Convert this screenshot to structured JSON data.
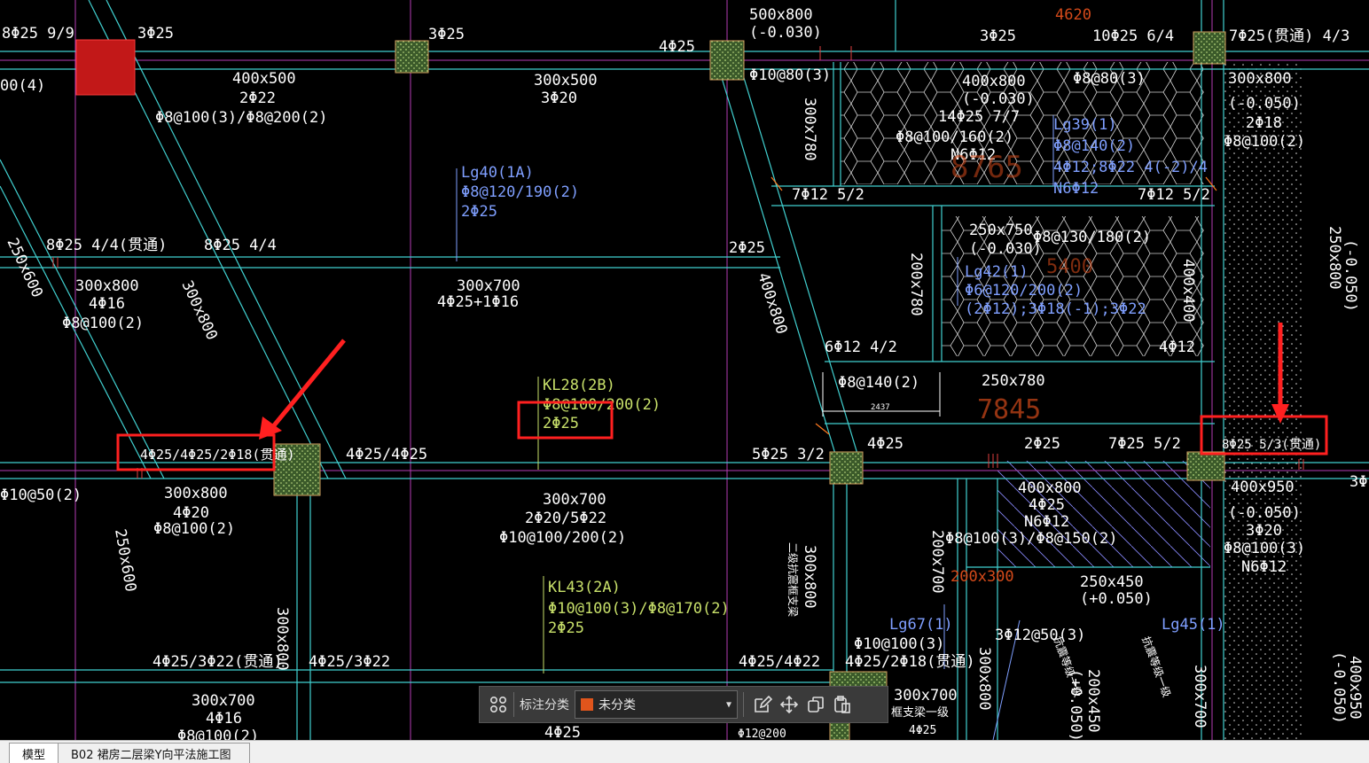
{
  "drawing": {
    "labels": {
      "a1": "8Φ25 9/9",
      "a2": "3Φ25",
      "a3": "00(4)",
      "a4": "3Φ25",
      "a5": "4Φ25",
      "a6": "500x800",
      "a7": "(-0.030)",
      "a8": "Φ10@80(3)",
      "a9": "3Φ25",
      "a10": "10Φ25 6/4",
      "a11": "7Φ25(贯通) 4/3",
      "a12": "4620",
      "a13": "400x500",
      "a14": "2Φ22",
      "a15": "Φ8@100(3)/Φ8@200(2)",
      "a16": "300x500",
      "a17": "3Φ20",
      "a18": "400x800",
      "a19": "(-0.030)",
      "a20": "14Φ25 7/7",
      "a21": "Φ8@100/160(2)",
      "a22": "N6Φ12",
      "a23": "Φ8@80(3)",
      "a24": "Lg39(1)",
      "a25": "Φ8@140(2)",
      "a26": "4Φ12;8Φ22 4(-2)/4",
      "a27": "N6Φ12",
      "a28": "8765",
      "a29": "300x800",
      "a30": "(-0.050)",
      "a31": "2Φ18",
      "a32": "Φ8@100(2)",
      "a33": "300x780",
      "a34": "Lg40(1A)",
      "a35": "Φ8@120/190(2)",
      "a36": "2Φ25",
      "a37": "7Φ12 5/2",
      "a38": "7Φ12 5/2",
      "a39": "8Φ25 4/4(贯通)",
      "a40": "8Φ25 4/4",
      "a41": "2Φ25",
      "a42": "250x750",
      "a43": "(-0.030)",
      "a44": "Φ8@130/180(2)",
      "a45": "Lg42(1)",
      "a46": "Φ6@120/200(2)",
      "a47": "(2Φ12);3Φ18(-1);3Φ22",
      "a48": "5400",
      "a49": "250x600",
      "a50": "300x800",
      "a51": "4Φ16",
      "a52": "Φ8@100(2)",
      "a53": "300x800",
      "a54": "300x700",
      "a55": "4Φ25+1Φ16",
      "a56": "400x800",
      "a57": "200x780",
      "a58": "400x400",
      "a59": "250x800",
      "a60": "(-0.050)",
      "a61": "6Φ12 4/2",
      "a62": "4Φ12",
      "a63": "Φ8@140(2)",
      "a64": "2437",
      "a65": "250x780",
      "a66": "7845",
      "a67": "KL28(2B)",
      "a68": "Φ8@100/200(2)",
      "a69": "2Φ25",
      "a70": "4Φ25/4Φ25/2Φ18(贯通)",
      "a71": "4Φ25/4Φ25",
      "a72": "5Φ25 3/2",
      "a73": "4Φ25",
      "a74": "2Φ25",
      "a75": "7Φ25 5/2",
      "a76": "8Φ25 5/3(贯通)",
      "a77": "3Φ",
      "a78": "Φ10@50(2)",
      "a79": "300x800",
      "a80": "4Φ20",
      "a81": "Φ8@100(2)",
      "a82": "300x700",
      "a83": "2Φ20/5Φ22",
      "a84": "Φ10@100/200(2)",
      "a85": "400x800",
      "a86": "4Φ25",
      "a87": "N6Φ12",
      "a88": "Φ8@100(3)/Φ8@150(2)",
      "a89": "400x950",
      "a90": "(-0.050)",
      "a91": "3Φ20",
      "a92": "Φ8@100(3)",
      "a93": "N6Φ12",
      "a94": "250x600",
      "a95": "200x700",
      "a96": "200x300",
      "a97": "KL43(2A)",
      "a98": "Φ10@100(3)/Φ8@170(2)",
      "a99": "2Φ25",
      "a100": "300x800",
      "a101": "250x450",
      "a102": "(+0.050)",
      "a103": "Lg67(1)",
      "a104": "Lg45(1)",
      "a105": "3Φ12@50(3)",
      "a106": "Φ10@100(3)",
      "a107": "4Φ25/2Φ18(贯通)",
      "a108": "4Φ25/3Φ22(贯通)",
      "a109": "4Φ25/3Φ22",
      "a110": "4Φ25/4Φ22",
      "a111": "300x700",
      "a112": "4Φ16",
      "a113": "Φ8@100(2)",
      "a114": "4Φ25",
      "a115": "300x700",
      "a116": "框支梁一级",
      "a117": "Φ12@200",
      "a118": "4Φ25",
      "a119": "300x800",
      "a120": "200x450",
      "a121": "(+0.050)",
      "a122": "300x700",
      "a123": "400x950",
      "a124": "(-0.050)",
      "a125": "300x800",
      "a126": "二级抗震框支梁",
      "a127": "抗震等级一级",
      "a128": "抗震等级一级"
    }
  },
  "toolbar": {
    "label": "标注分类",
    "select_value": "未分类",
    "swatch_color": "#e0551c"
  },
  "tabs": {
    "model": "模型",
    "layout": "B02 裙房二层梁Y向平法施工图"
  },
  "highlight_color": "#ff2020"
}
